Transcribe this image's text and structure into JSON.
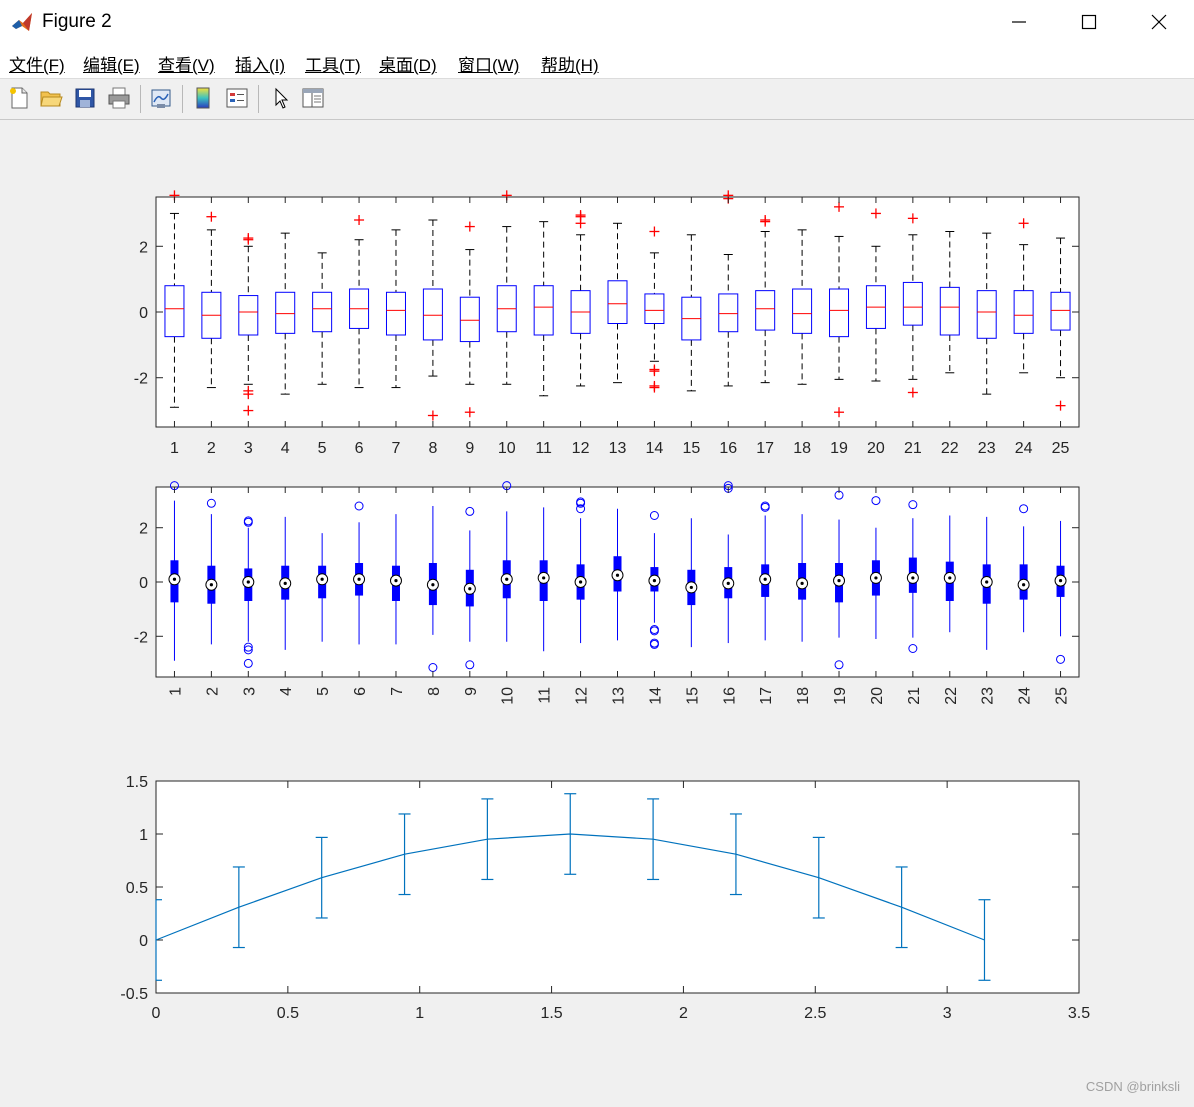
{
  "window": {
    "title": "Figure 2",
    "app_icon": "matlab-icon",
    "controls": [
      "minimize-icon",
      "maximize-icon",
      "close-icon"
    ]
  },
  "menubar": {
    "items": [
      "文件(F)",
      "编辑(E)",
      "查看(V)",
      "插入(I)",
      "工具(T)",
      "桌面(D)",
      "窗口(W)",
      "帮助(H)"
    ]
  },
  "toolbar": {
    "buttons": [
      "new-figure-icon",
      "open-file-icon",
      "save-icon",
      "print-icon",
      "link-plot-icon",
      "insert-colorbar-icon",
      "insert-legend-icon",
      "edit-plot-arrow-icon",
      "property-inspector-icon"
    ]
  },
  "watermark": "CSDN @brinksli",
  "colors": {
    "box_blue": "#0000ff",
    "median_red": "#ff0000",
    "outlier_red": "#ff0000",
    "whisker_black": "#000000",
    "errorbar_line": "#0072bd",
    "axes_bg": "#ffffff",
    "figure_bg": "#f0f0f0"
  },
  "chart_data": [
    {
      "type": "boxplot",
      "style": "traditional",
      "categories": [
        "1",
        "2",
        "3",
        "4",
        "5",
        "6",
        "7",
        "8",
        "9",
        "10",
        "11",
        "12",
        "13",
        "14",
        "15",
        "16",
        "17",
        "18",
        "19",
        "20",
        "21",
        "22",
        "23",
        "24",
        "25"
      ],
      "ylim": [
        -3.5,
        3.5
      ],
      "yticks": [
        -2,
        0,
        2
      ],
      "ytick_labels": [
        "-2",
        "0",
        "2"
      ],
      "grid": false,
      "boxes": [
        {
          "lw": -2.9,
          "q1": -0.75,
          "med": 0.1,
          "q3": 0.8,
          "uw": 3.0,
          "outliers": [
            3.55
          ]
        },
        {
          "lw": -2.3,
          "q1": -0.8,
          "med": -0.1,
          "q3": 0.6,
          "uw": 2.5,
          "outliers": [
            2.9
          ]
        },
        {
          "lw": -2.2,
          "q1": -0.7,
          "med": 0.0,
          "q3": 0.5,
          "uw": 2.0,
          "outliers": [
            2.25,
            2.2,
            -2.4,
            -2.5,
            -3.0
          ]
        },
        {
          "lw": -2.5,
          "q1": -0.65,
          "med": -0.05,
          "q3": 0.6,
          "uw": 2.4,
          "outliers": []
        },
        {
          "lw": -2.2,
          "q1": -0.6,
          "med": 0.1,
          "q3": 0.6,
          "uw": 1.8,
          "outliers": []
        },
        {
          "lw": -2.3,
          "q1": -0.5,
          "med": 0.1,
          "q3": 0.7,
          "uw": 2.2,
          "outliers": [
            2.8
          ]
        },
        {
          "lw": -2.3,
          "q1": -0.7,
          "med": 0.05,
          "q3": 0.6,
          "uw": 2.5,
          "outliers": []
        },
        {
          "lw": -1.95,
          "q1": -0.85,
          "med": -0.1,
          "q3": 0.7,
          "uw": 2.8,
          "outliers": [
            -3.15
          ]
        },
        {
          "lw": -2.2,
          "q1": -0.9,
          "med": -0.25,
          "q3": 0.45,
          "uw": 1.9,
          "outliers": [
            2.6,
            -3.05
          ]
        },
        {
          "lw": -2.2,
          "q1": -0.6,
          "med": 0.1,
          "q3": 0.8,
          "uw": 2.6,
          "outliers": [
            3.55
          ]
        },
        {
          "lw": -2.55,
          "q1": -0.7,
          "med": 0.15,
          "q3": 0.8,
          "uw": 2.75,
          "outliers": []
        },
        {
          "lw": -2.25,
          "q1": -0.65,
          "med": 0.0,
          "q3": 0.65,
          "uw": 2.35,
          "outliers": [
            2.95,
            2.9,
            2.7
          ]
        },
        {
          "lw": -2.15,
          "q1": -0.35,
          "med": 0.25,
          "q3": 0.95,
          "uw": 2.7,
          "outliers": []
        },
        {
          "lw": -1.5,
          "q1": -0.35,
          "med": 0.05,
          "q3": 0.55,
          "uw": 1.8,
          "outliers": [
            -1.75,
            -1.8,
            -2.3,
            -2.25,
            2.45
          ]
        },
        {
          "lw": -2.4,
          "q1": -0.85,
          "med": -0.2,
          "q3": 0.45,
          "uw": 2.35,
          "outliers": []
        },
        {
          "lw": -2.25,
          "q1": -0.6,
          "med": -0.05,
          "q3": 0.55,
          "uw": 1.75,
          "outliers": [
            3.45,
            3.55
          ]
        },
        {
          "lw": -2.15,
          "q1": -0.55,
          "med": 0.1,
          "q3": 0.65,
          "uw": 2.45,
          "outliers": [
            2.8,
            2.75
          ]
        },
        {
          "lw": -2.2,
          "q1": -0.65,
          "med": -0.05,
          "q3": 0.7,
          "uw": 2.5,
          "outliers": []
        },
        {
          "lw": -2.05,
          "q1": -0.75,
          "med": 0.05,
          "q3": 0.7,
          "uw": 2.3,
          "outliers": [
            3.2,
            -3.05
          ]
        },
        {
          "lw": -2.1,
          "q1": -0.5,
          "med": 0.15,
          "q3": 0.8,
          "uw": 2.0,
          "outliers": [
            3.0
          ]
        },
        {
          "lw": -2.05,
          "q1": -0.4,
          "med": 0.15,
          "q3": 0.9,
          "uw": 2.35,
          "outliers": [
            2.85,
            -2.45
          ]
        },
        {
          "lw": -1.85,
          "q1": -0.7,
          "med": 0.15,
          "q3": 0.75,
          "uw": 2.45,
          "outliers": []
        },
        {
          "lw": -2.5,
          "q1": -0.8,
          "med": 0.0,
          "q3": 0.65,
          "uw": 2.4,
          "outliers": []
        },
        {
          "lw": -1.85,
          "q1": -0.65,
          "med": -0.1,
          "q3": 0.65,
          "uw": 2.05,
          "outliers": [
            2.7
          ]
        },
        {
          "lw": -2.0,
          "q1": -0.55,
          "med": 0.05,
          "q3": 0.6,
          "uw": 2.25,
          "outliers": [
            -2.85
          ]
        }
      ]
    },
    {
      "type": "boxplot",
      "style": "compact",
      "categories": [
        "1",
        "2",
        "3",
        "4",
        "5",
        "6",
        "7",
        "8",
        "9",
        "10",
        "11",
        "12",
        "13",
        "14",
        "15",
        "16",
        "17",
        "18",
        "19",
        "20",
        "21",
        "22",
        "23",
        "24",
        "25"
      ],
      "ylim": [
        -3.5,
        3.5
      ],
      "yticks": [
        -2,
        0,
        2
      ],
      "ytick_labels": [
        "-2",
        "0",
        "2"
      ],
      "xtick_rotation": "vertical",
      "grid": false,
      "uses_boxes_of_chart": 0
    },
    {
      "type": "errorbar",
      "x": [
        0,
        0.3142,
        0.6283,
        0.9425,
        1.2566,
        1.5708,
        1.885,
        2.1991,
        2.5133,
        2.8274,
        3.1416
      ],
      "y": [
        0,
        0.309,
        0.5878,
        0.809,
        0.9511,
        1.0,
        0.9511,
        0.809,
        0.5878,
        0.309,
        0
      ],
      "err": [
        0.38,
        0.38,
        0.38,
        0.38,
        0.38,
        0.38,
        0.38,
        0.38,
        0.38,
        0.38,
        0.38
      ],
      "xlim": [
        0,
        3.5
      ],
      "ylim": [
        -0.5,
        1.5
      ],
      "xticks": [
        0,
        0.5,
        1,
        1.5,
        2,
        2.5,
        3,
        3.5
      ],
      "xtick_labels": [
        "0",
        "0.5",
        "1",
        "1.5",
        "2",
        "2.5",
        "3",
        "3.5"
      ],
      "yticks": [
        -0.5,
        0,
        0.5,
        1,
        1.5
      ],
      "ytick_labels": [
        "-0.5",
        "0",
        "0.5",
        "1",
        "1.5"
      ],
      "grid": false
    }
  ]
}
